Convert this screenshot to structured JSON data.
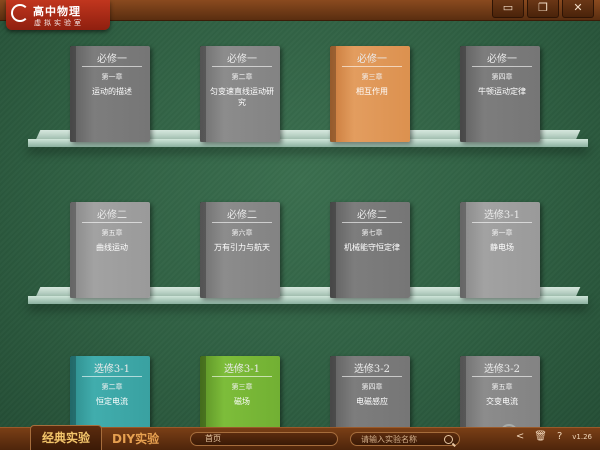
{
  "app": {
    "logo_title": "高中物理",
    "logo_subtitle": "虚拟实验室"
  },
  "window_buttons": {
    "minimize": "▭",
    "restore": "❐",
    "close": "✕"
  },
  "shelves": [
    {
      "books": [
        {
          "series": "必修一",
          "chapter": "第一章",
          "title": "运动的描述",
          "color": "gray1"
        },
        {
          "series": "必修一",
          "chapter": "第二章",
          "title": "匀变速直线运动研究",
          "color": "gray2"
        },
        {
          "series": "必修一",
          "chapter": "第三章",
          "title": "相互作用",
          "color": "orange"
        },
        {
          "series": "必修一",
          "chapter": "第四章",
          "title": "牛顿运动定律",
          "color": "gray1"
        }
      ]
    },
    {
      "books": [
        {
          "series": "必修二",
          "chapter": "第五章",
          "title": "曲线运动",
          "color": "gray3"
        },
        {
          "series": "必修二",
          "chapter": "第六章",
          "title": "万有引力与航天",
          "color": "gray2"
        },
        {
          "series": "必修二",
          "chapter": "第七章",
          "title": "机械能守恒定律",
          "color": "gray1"
        },
        {
          "series": "选修3-1",
          "chapter": "第一章",
          "title": "静电场",
          "color": "gray3"
        }
      ]
    },
    {
      "books": [
        {
          "series": "选修3-1",
          "chapter": "第二章",
          "title": "恒定电流",
          "color": "teal"
        },
        {
          "series": "选修3-1",
          "chapter": "第三章",
          "title": "磁场",
          "color": "green"
        },
        {
          "series": "选修3-2",
          "chapter": "第四章",
          "title": "电磁感应",
          "color": "gray1"
        },
        {
          "series": "选修3-2",
          "chapter": "第五章",
          "title": "交变电流",
          "color": "gray2"
        }
      ]
    }
  ],
  "bottom": {
    "tab_classic": "经典实验",
    "tab_diy": "DIY实验",
    "breadcrumb": "首页",
    "search_placeholder": "请输入实验名称",
    "version": "v1.26"
  }
}
